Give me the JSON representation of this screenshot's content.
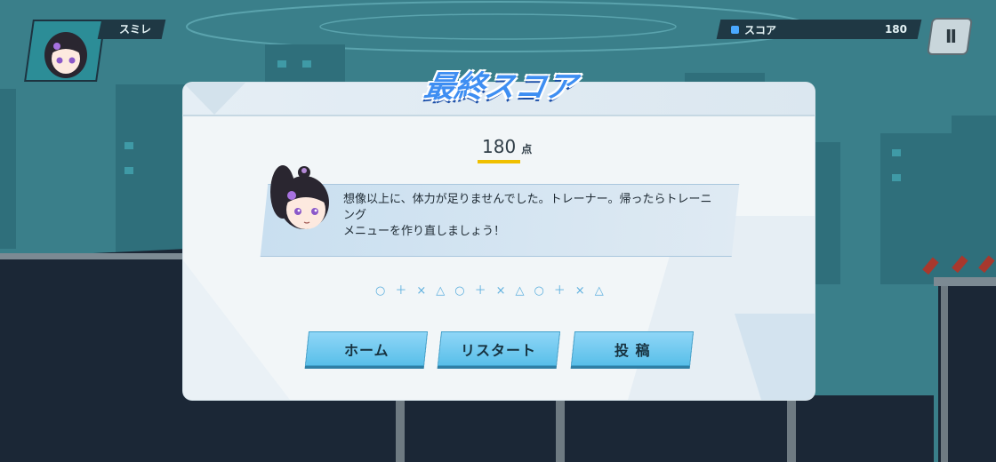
{
  "hud": {
    "player_name": "スミレ",
    "score_label": "スコア",
    "score_value": "180",
    "pause_label": "II"
  },
  "dialog": {
    "title": "最終スコア",
    "score": "180",
    "score_unit": "点",
    "message_line1": "想像以上に、体力が足りませんでした。トレーナー。帰ったらトレーニング",
    "message_line2": "メニューを作り直しましょう！",
    "symbols": "○＋×△○＋×△○＋×△",
    "buttons": {
      "home": "ホーム",
      "restart": "リスタート",
      "post": "投 稿"
    }
  },
  "colors": {
    "accent": "#59bfe9",
    "title_blue": "#3e8ef2",
    "underline": "#f0c000",
    "background_teal": "#3a7f8a"
  }
}
